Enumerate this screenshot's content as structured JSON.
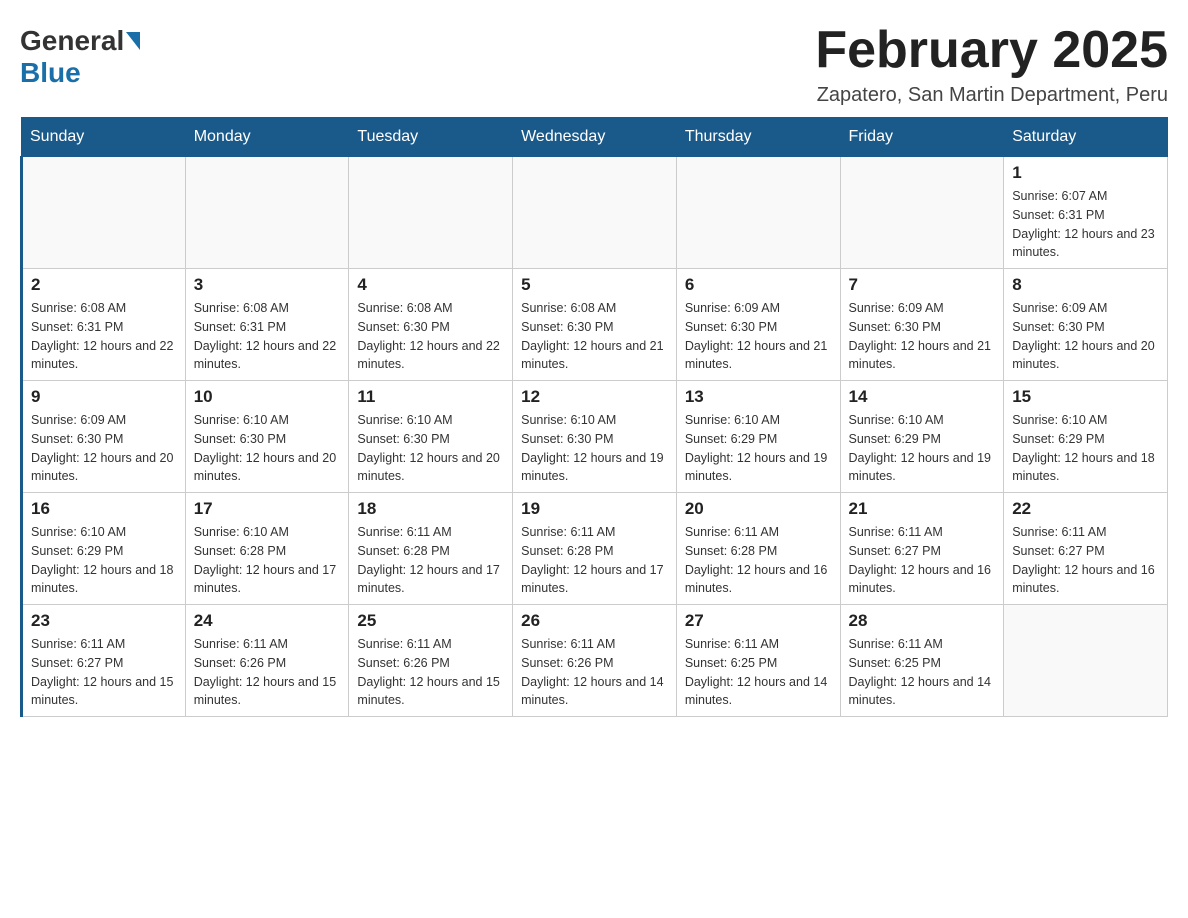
{
  "header": {
    "logo": {
      "general": "General",
      "blue": "Blue"
    },
    "title": "February 2025",
    "location": "Zapatero, San Martin Department, Peru"
  },
  "days_of_week": [
    "Sunday",
    "Monday",
    "Tuesday",
    "Wednesday",
    "Thursday",
    "Friday",
    "Saturday"
  ],
  "weeks": [
    {
      "days": [
        {
          "number": "",
          "info": ""
        },
        {
          "number": "",
          "info": ""
        },
        {
          "number": "",
          "info": ""
        },
        {
          "number": "",
          "info": ""
        },
        {
          "number": "",
          "info": ""
        },
        {
          "number": "",
          "info": ""
        },
        {
          "number": "1",
          "info": "Sunrise: 6:07 AM\nSunset: 6:31 PM\nDaylight: 12 hours and 23 minutes."
        }
      ]
    },
    {
      "days": [
        {
          "number": "2",
          "info": "Sunrise: 6:08 AM\nSunset: 6:31 PM\nDaylight: 12 hours and 22 minutes."
        },
        {
          "number": "3",
          "info": "Sunrise: 6:08 AM\nSunset: 6:31 PM\nDaylight: 12 hours and 22 minutes."
        },
        {
          "number": "4",
          "info": "Sunrise: 6:08 AM\nSunset: 6:30 PM\nDaylight: 12 hours and 22 minutes."
        },
        {
          "number": "5",
          "info": "Sunrise: 6:08 AM\nSunset: 6:30 PM\nDaylight: 12 hours and 21 minutes."
        },
        {
          "number": "6",
          "info": "Sunrise: 6:09 AM\nSunset: 6:30 PM\nDaylight: 12 hours and 21 minutes."
        },
        {
          "number": "7",
          "info": "Sunrise: 6:09 AM\nSunset: 6:30 PM\nDaylight: 12 hours and 21 minutes."
        },
        {
          "number": "8",
          "info": "Sunrise: 6:09 AM\nSunset: 6:30 PM\nDaylight: 12 hours and 20 minutes."
        }
      ]
    },
    {
      "days": [
        {
          "number": "9",
          "info": "Sunrise: 6:09 AM\nSunset: 6:30 PM\nDaylight: 12 hours and 20 minutes."
        },
        {
          "number": "10",
          "info": "Sunrise: 6:10 AM\nSunset: 6:30 PM\nDaylight: 12 hours and 20 minutes."
        },
        {
          "number": "11",
          "info": "Sunrise: 6:10 AM\nSunset: 6:30 PM\nDaylight: 12 hours and 20 minutes."
        },
        {
          "number": "12",
          "info": "Sunrise: 6:10 AM\nSunset: 6:30 PM\nDaylight: 12 hours and 19 minutes."
        },
        {
          "number": "13",
          "info": "Sunrise: 6:10 AM\nSunset: 6:29 PM\nDaylight: 12 hours and 19 minutes."
        },
        {
          "number": "14",
          "info": "Sunrise: 6:10 AM\nSunset: 6:29 PM\nDaylight: 12 hours and 19 minutes."
        },
        {
          "number": "15",
          "info": "Sunrise: 6:10 AM\nSunset: 6:29 PM\nDaylight: 12 hours and 18 minutes."
        }
      ]
    },
    {
      "days": [
        {
          "number": "16",
          "info": "Sunrise: 6:10 AM\nSunset: 6:29 PM\nDaylight: 12 hours and 18 minutes."
        },
        {
          "number": "17",
          "info": "Sunrise: 6:10 AM\nSunset: 6:28 PM\nDaylight: 12 hours and 17 minutes."
        },
        {
          "number": "18",
          "info": "Sunrise: 6:11 AM\nSunset: 6:28 PM\nDaylight: 12 hours and 17 minutes."
        },
        {
          "number": "19",
          "info": "Sunrise: 6:11 AM\nSunset: 6:28 PM\nDaylight: 12 hours and 17 minutes."
        },
        {
          "number": "20",
          "info": "Sunrise: 6:11 AM\nSunset: 6:28 PM\nDaylight: 12 hours and 16 minutes."
        },
        {
          "number": "21",
          "info": "Sunrise: 6:11 AM\nSunset: 6:27 PM\nDaylight: 12 hours and 16 minutes."
        },
        {
          "number": "22",
          "info": "Sunrise: 6:11 AM\nSunset: 6:27 PM\nDaylight: 12 hours and 16 minutes."
        }
      ]
    },
    {
      "days": [
        {
          "number": "23",
          "info": "Sunrise: 6:11 AM\nSunset: 6:27 PM\nDaylight: 12 hours and 15 minutes."
        },
        {
          "number": "24",
          "info": "Sunrise: 6:11 AM\nSunset: 6:26 PM\nDaylight: 12 hours and 15 minutes."
        },
        {
          "number": "25",
          "info": "Sunrise: 6:11 AM\nSunset: 6:26 PM\nDaylight: 12 hours and 15 minutes."
        },
        {
          "number": "26",
          "info": "Sunrise: 6:11 AM\nSunset: 6:26 PM\nDaylight: 12 hours and 14 minutes."
        },
        {
          "number": "27",
          "info": "Sunrise: 6:11 AM\nSunset: 6:25 PM\nDaylight: 12 hours and 14 minutes."
        },
        {
          "number": "28",
          "info": "Sunrise: 6:11 AM\nSunset: 6:25 PM\nDaylight: 12 hours and 14 minutes."
        },
        {
          "number": "",
          "info": ""
        }
      ]
    }
  ]
}
